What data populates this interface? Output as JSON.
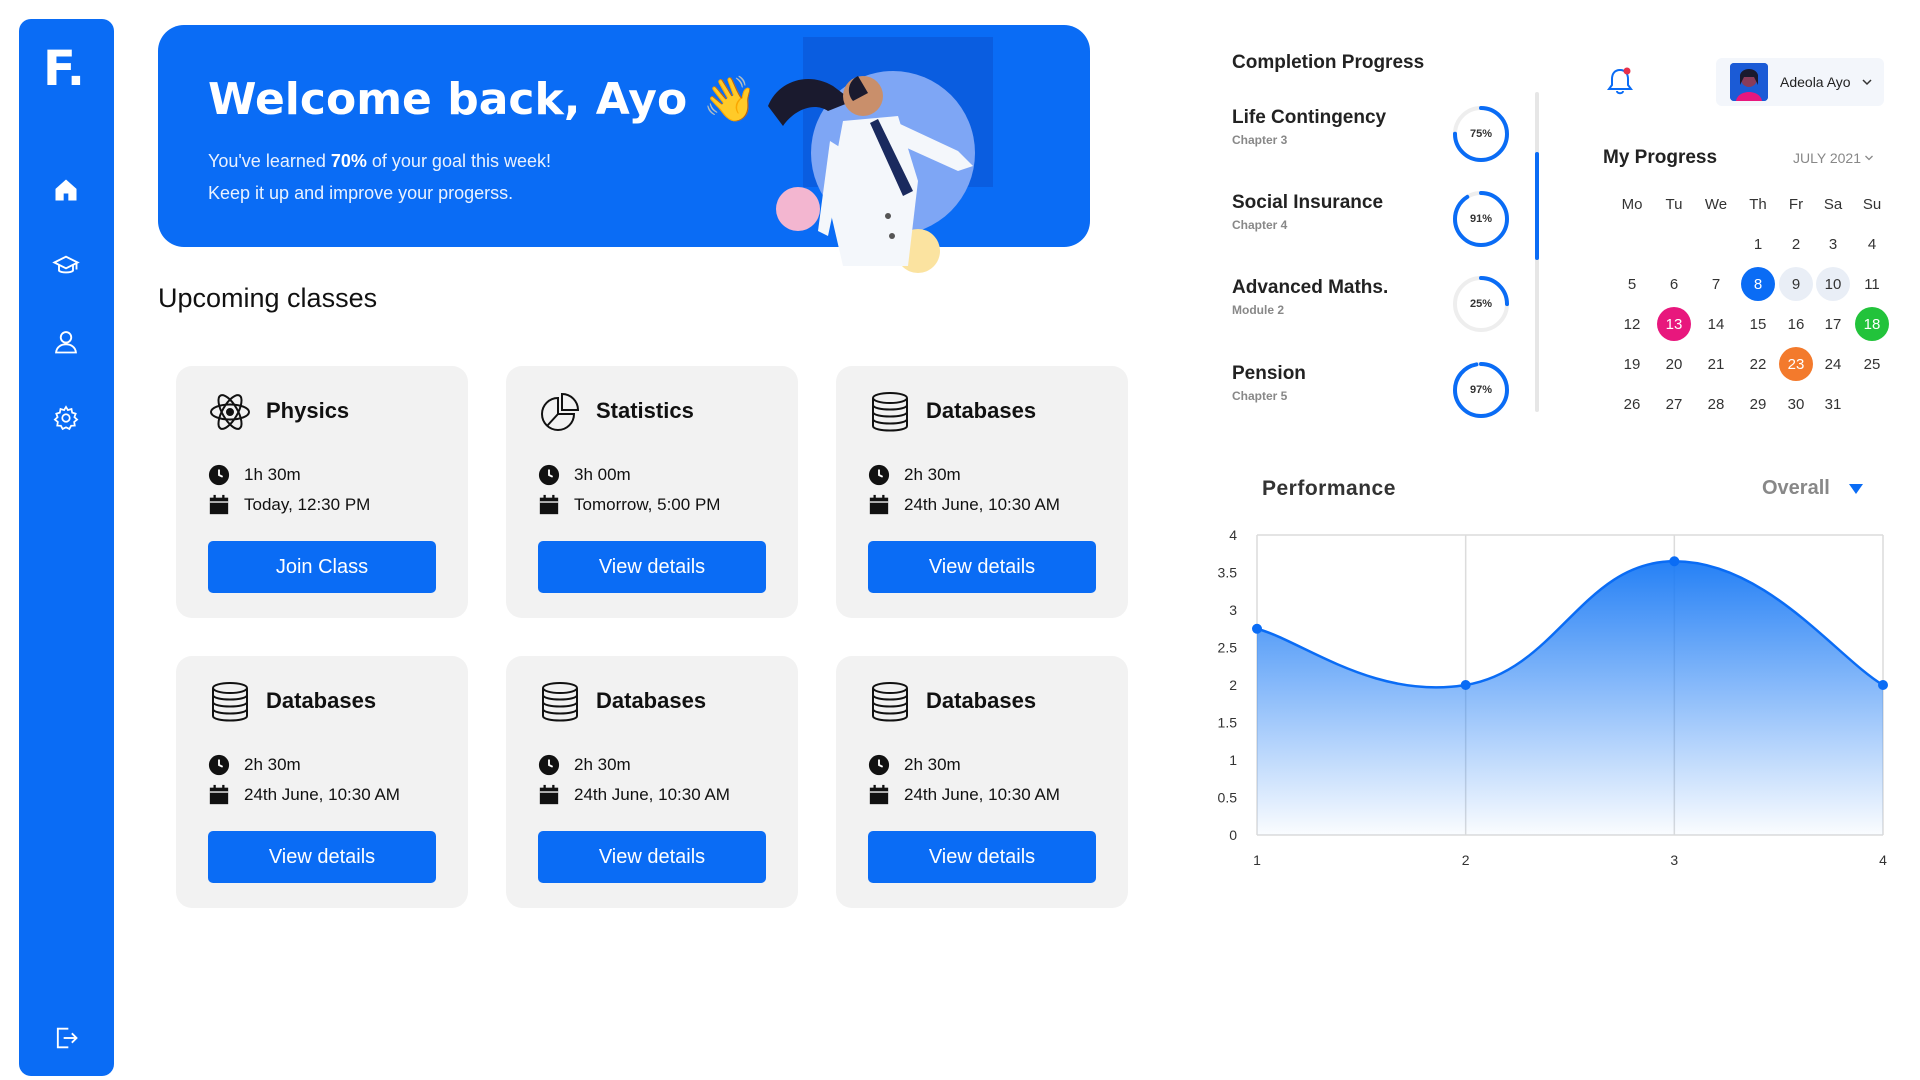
{
  "sidebar": {
    "logo": "F.",
    "items": [
      {
        "name": "home",
        "icon": "home-icon"
      },
      {
        "name": "courses",
        "icon": "graduation-cap-icon"
      },
      {
        "name": "profile",
        "icon": "user-icon"
      },
      {
        "name": "settings",
        "icon": "gear-icon"
      }
    ],
    "logout_icon": "logout-icon"
  },
  "hero": {
    "title": "Welcome back, Ayo 👋",
    "line1_prefix": "You've learned ",
    "line1_bold": "70%",
    "line1_suffix": "  of your goal this week!",
    "line2": "Keep it up and improve your progerss."
  },
  "upcoming": {
    "title": "Upcoming classes",
    "classes": [
      {
        "name": "Physics",
        "icon": "atom-icon",
        "duration": "1h 30m",
        "when": "Today, 12:30 PM",
        "button": "Join Class"
      },
      {
        "name": "Statistics",
        "icon": "pie-chart-icon",
        "duration": "3h 00m",
        "when": "Tomorrow, 5:00 PM",
        "button": "View details"
      },
      {
        "name": "Databases",
        "icon": "database-icon",
        "duration": "2h 30m",
        "when": "24th June, 10:30 AM",
        "button": "View details"
      },
      {
        "name": "Databases",
        "icon": "database-icon",
        "duration": "2h 30m",
        "when": "24th June, 10:30 AM",
        "button": "View details"
      },
      {
        "name": "Databases",
        "icon": "database-icon",
        "duration": "2h 30m",
        "when": "24th June, 10:30 AM",
        "button": "View details"
      },
      {
        "name": "Databases",
        "icon": "database-icon",
        "duration": "2h 30m",
        "when": "24th June, 10:30 AM",
        "button": "View details"
      }
    ]
  },
  "completion": {
    "title": "Completion Progress",
    "items": [
      {
        "name": "Life Contingency",
        "sub": "Chapter 3",
        "percent": 75,
        "label": "75%"
      },
      {
        "name": "Social Insurance",
        "sub": "Chapter 4",
        "percent": 91,
        "label": "91%"
      },
      {
        "name": "Advanced Maths.",
        "sub": "Module 2",
        "percent": 25,
        "label": "25%"
      },
      {
        "name": "Pension",
        "sub": "Chapter 5",
        "percent": 97,
        "label": "97%"
      }
    ]
  },
  "header": {
    "user_name": "Adeola Ayo",
    "bell_icon": "bell-icon",
    "notification_dot_color": "#e8304a"
  },
  "calendar": {
    "title": "My Progress",
    "month": "JULY 2021",
    "weekdays": [
      "Mo",
      "Tu",
      "We",
      "Th",
      "Fr",
      "Sa",
      "Su"
    ],
    "start_weekday_index": 3,
    "days_in_month": 31,
    "highlights": [
      {
        "day": 8,
        "color": "#0a6cf5",
        "text_color": "#ffffff"
      },
      {
        "day": 9,
        "color": "#e9eef6",
        "text_color": "#333333"
      },
      {
        "day": 10,
        "color": "#e9eef6",
        "text_color": "#333333"
      },
      {
        "day": 13,
        "color": "#e8177d",
        "text_color": "#ffffff"
      },
      {
        "day": 18,
        "color": "#22c33b",
        "text_color": "#ffffff"
      },
      {
        "day": 23,
        "color": "#f37a2c",
        "text_color": "#ffffff"
      }
    ]
  },
  "performance": {
    "title": "Performance",
    "filter": "Overall",
    "accent": "#0a6cf5"
  },
  "chart_data": {
    "type": "area",
    "x": [
      1,
      2,
      3,
      4
    ],
    "values": [
      2.75,
      2.0,
      3.65,
      2.0
    ],
    "xticks": [
      "1",
      "2",
      "3",
      "4"
    ],
    "yticks": [
      "0",
      "0.5",
      "1",
      "1.5",
      "2",
      "2.5",
      "3",
      "3.5",
      "4"
    ],
    "xlim": [
      1,
      4
    ],
    "ylim": [
      0,
      4
    ],
    "grid": true,
    "title": "",
    "xlabel": "",
    "ylabel": ""
  }
}
